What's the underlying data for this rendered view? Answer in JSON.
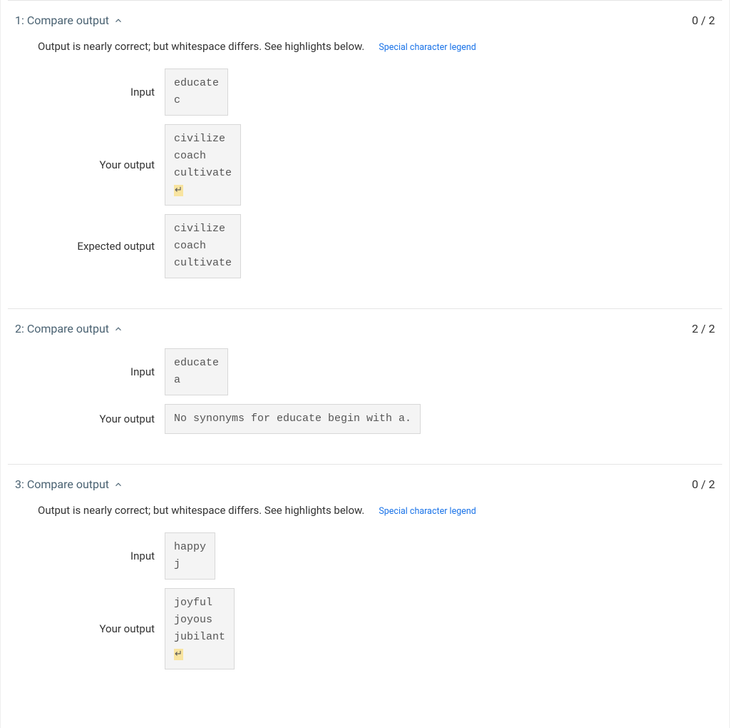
{
  "sections": [
    {
      "num": "1",
      "title": "Compare output",
      "score": "0 / 2",
      "message": "Output is nearly correct; but whitespace differs. See highlights below.",
      "legend": "Special character legend",
      "rows": [
        {
          "label": "Input",
          "content": "educate\nc",
          "trailing_newline": false
        },
        {
          "label": "Your output",
          "content": "civilize\ncoach\ncultivate",
          "trailing_newline": true
        },
        {
          "label": "Expected output",
          "content": "civilize\ncoach\ncultivate",
          "trailing_newline": false
        }
      ]
    },
    {
      "num": "2",
      "title": "Compare output",
      "score": "2 / 2",
      "message": "",
      "legend": "",
      "rows": [
        {
          "label": "Input",
          "content": "educate\na",
          "trailing_newline": false
        },
        {
          "label": "Your output",
          "content": "No synonyms for educate begin with a.",
          "trailing_newline": false
        }
      ]
    },
    {
      "num": "3",
      "title": "Compare output",
      "score": "0 / 2",
      "message": "Output is nearly correct; but whitespace differs. See highlights below.",
      "legend": "Special character legend",
      "rows": [
        {
          "label": "Input",
          "content": "happy\nj",
          "trailing_newline": false
        },
        {
          "label": "Your output",
          "content": "joyful\njoyous\njubilant",
          "trailing_newline": true
        }
      ]
    }
  ],
  "newline_glyph": "↵"
}
